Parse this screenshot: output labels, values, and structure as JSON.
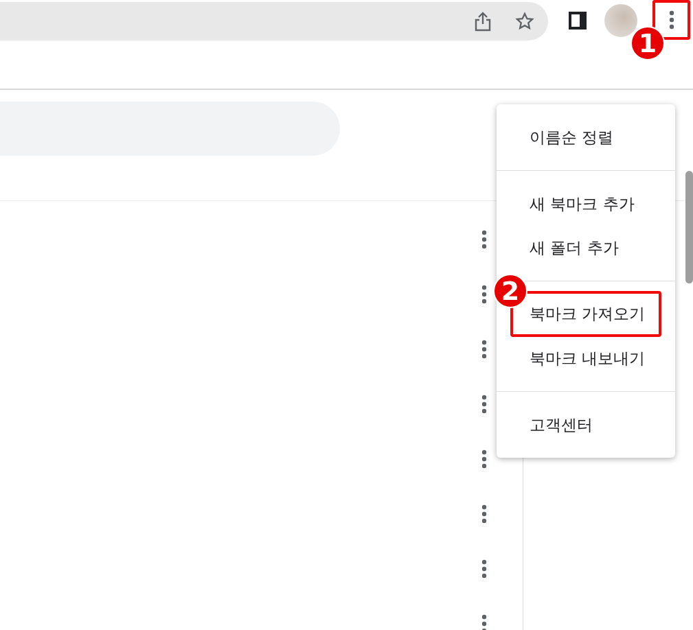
{
  "toolbar": {
    "menu_button": {
      "annotated": true,
      "badge": "1"
    }
  },
  "search": {
    "kind": "pill"
  },
  "rows": [
    {
      "kind": "bookmark"
    },
    {
      "kind": "bookmark"
    },
    {
      "kind": "bookmark"
    },
    {
      "kind": "bookmark"
    },
    {
      "kind": "bookmark"
    },
    {
      "kind": "bookmark"
    },
    {
      "kind": "bookmark"
    },
    {
      "kind": "bookmark"
    }
  ],
  "menu": {
    "sections": [
      {
        "items": [
          {
            "label": "이름순 정렬",
            "annotated": false
          }
        ]
      },
      {
        "items": [
          {
            "label": "새 북마크 추가",
            "annotated": false
          },
          {
            "label": "새 폴더 추가",
            "annotated": false
          }
        ]
      },
      {
        "items": [
          {
            "label": "북마크 가져오기",
            "annotated": true,
            "badge": "2"
          },
          {
            "label": "북마크 내보내기",
            "annotated": false
          }
        ]
      },
      {
        "items": [
          {
            "label": "고객센터",
            "annotated": false
          }
        ]
      }
    ]
  }
}
